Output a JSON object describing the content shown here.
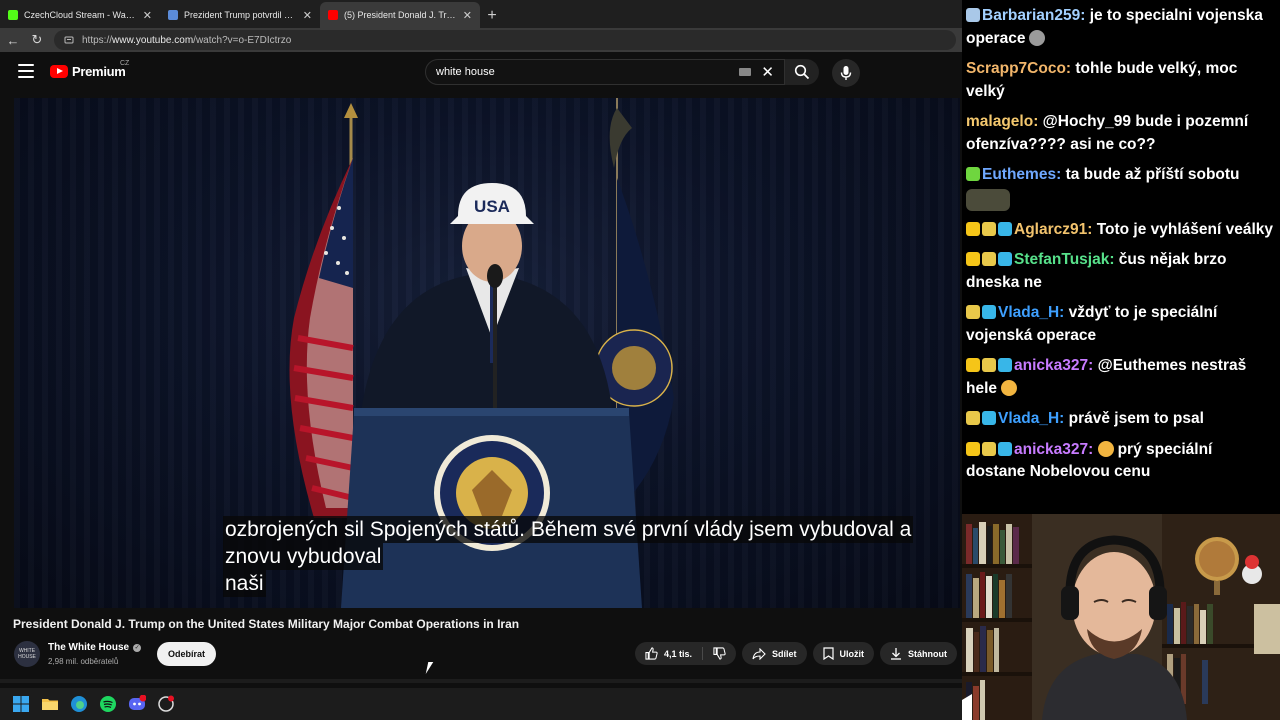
{
  "browser": {
    "tabs": [
      {
        "title": "CzechCloud Stream - Watch Live o",
        "favicon_color": "#53fc18",
        "active": false
      },
      {
        "title": "Prezident Trump potvrdil vojenský",
        "favicon_color": "#5b8bd8",
        "active": false
      },
      {
        "title": "(5) President Donald J. Trump on t",
        "favicon_color": "#ff0000",
        "active": true
      }
    ],
    "new_tab": "+",
    "url_prefix": "https://",
    "url_host": "www.youtube.com",
    "url_path": "/watch?v=o-E7DIctrzo"
  },
  "youtube": {
    "logo_text": "Premium",
    "region": "CZ",
    "search_value": "white house",
    "subtitles": [
      "ozbrojených sil Spojených států.  Během své první vlády jsem vybudoval a",
      "znovu vybudoval",
      "naši"
    ],
    "video_title": "President Donald J. Trump on the United States Military Major Combat Operations in Iran",
    "channel_name": "The White House",
    "subscribers": "2,98 mil. odběratelů",
    "subscribe_label": "Odebírat",
    "likes": "4,1 tis.",
    "share_label": "Sdílet",
    "save_label": "Uložit",
    "download_label": "Stáhnout",
    "podium_text": "USA"
  },
  "chat": [
    {
      "user": "Barbarian259",
      "color": "#a2d0ff",
      "text": "je to specialni vojenska operace",
      "badges": [
        "#a9c8e8"
      ],
      "emote": "#9a9a9a"
    },
    {
      "user": "Scrapp7Coco",
      "color": "#f2b66b",
      "text": "tohle bude velký, moc velký",
      "badges": [],
      "emote": ""
    },
    {
      "user": "malagelo",
      "color": "#f4c86e",
      "text": "@Hochy_99 bude i pozemní ofenzíva???? asi ne co??",
      "badges": [],
      "emote": ""
    },
    {
      "user": "Euthemes",
      "color": "#6fa8ff",
      "text": "ta bude až příští sobotu",
      "badges": [
        "#6fd63f"
      ],
      "emote": "#4b4b3a"
    },
    {
      "user": "Aglarcz91",
      "color": "#f2c36d",
      "text": "Toto je vyhlášení veálky",
      "badges": [
        "#f5c518",
        "#e8c84a",
        "#38b6e8"
      ],
      "emote": ""
    },
    {
      "user": "StefanTusjak",
      "color": "#57e08a",
      "text": "čus nějak brzo dneska ne",
      "badges": [
        "#f5c518",
        "#e8c84a",
        "#38b6e8"
      ],
      "emote": ""
    },
    {
      "user": "Vlada_H",
      "color": "#3ea0ff",
      "text": "vždyť to je speciální vojenská operace",
      "badges": [
        "#e8c84a",
        "#38b6e8"
      ],
      "emote": ""
    },
    {
      "user": "anicka327",
      "color": "#c77bff",
      "text": "@Euthemes nestraš hele",
      "badges": [
        "#f5c518",
        "#e8c84a",
        "#38b6e8"
      ],
      "emote": "#f2b540"
    },
    {
      "user": "Vlada_H",
      "color": "#3ea0ff",
      "text": "právě jsem to psal",
      "badges": [
        "#e8c84a",
        "#38b6e8"
      ],
      "emote": ""
    },
    {
      "user": "anicka327",
      "color": "#c77bff",
      "text": "prý speciální dostane Nobelovou cenu",
      "badges": [
        "#f5c518",
        "#e8c84a",
        "#38b6e8"
      ],
      "emote_before": "#f2b540"
    }
  ],
  "taskbar": {
    "icons": [
      "windows-start",
      "file-explorer",
      "edge-browser",
      "spotify",
      "discord",
      "app"
    ],
    "discord_badge": "91"
  }
}
